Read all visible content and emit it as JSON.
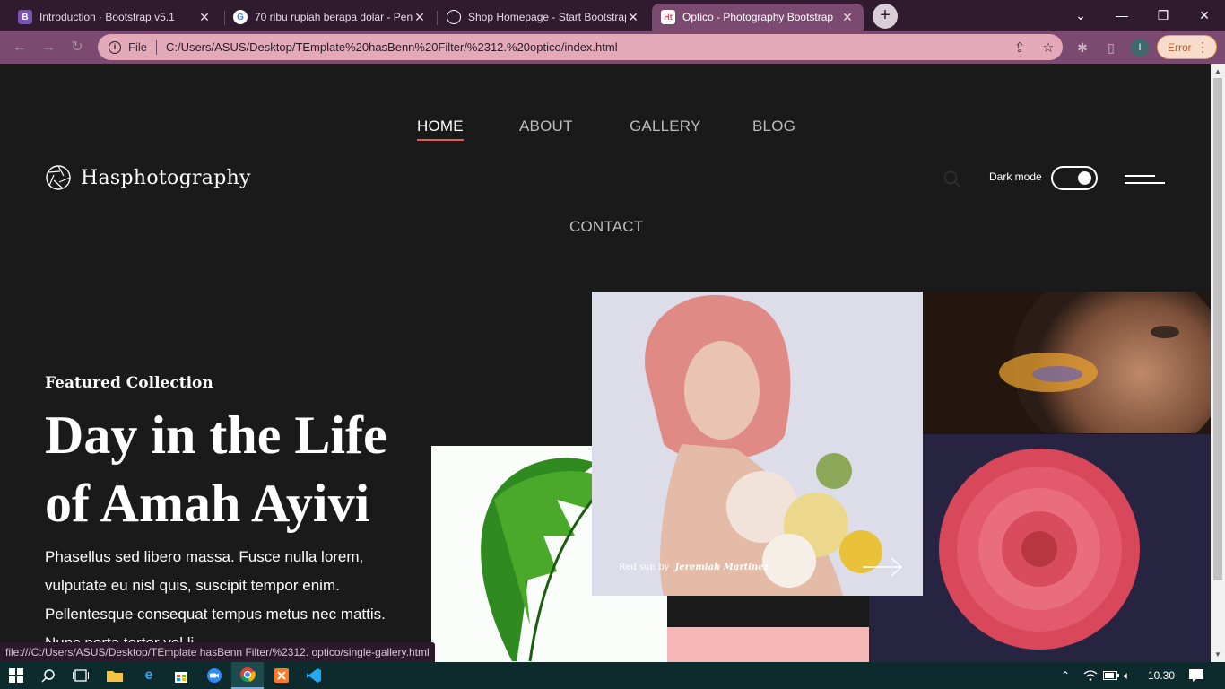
{
  "browser": {
    "tabs": [
      {
        "title": "Introduction · Bootstrap v5.1",
        "favicon": "B",
        "favicon_color": "#7952b3"
      },
      {
        "title": "70 ribu rupiah berapa dolar - Pen",
        "favicon": "G",
        "favicon_color": "#ffffff"
      },
      {
        "title": "Shop Homepage - Start Bootstrap",
        "favicon": "globe",
        "favicon_color": "#ffffff"
      },
      {
        "title": "Optico - Photography Bootstrap",
        "favicon": "Ht",
        "favicon_color": "#ffffff"
      }
    ],
    "active_tab": 3,
    "address": {
      "scheme_label": "File",
      "url": "C:/Users/ASUS/Desktop/TEmplate%20hasBenn%20Filter/%2312.%20optico/index.html"
    },
    "profile_initial": "I",
    "error_label": "Error"
  },
  "site": {
    "nav": {
      "home": "HOME",
      "about": "ABOUT",
      "gallery": "GALLERY",
      "blog": "BLOG",
      "contact": "CONTACT"
    },
    "brand": "Hasphotography",
    "dark_mode_label": "Dark mode",
    "dark_mode_on": true,
    "hero": {
      "eyebrow": "Featured Collection",
      "title": "Day in the Life of Amah Ayivi",
      "text": "Phasellus sed libero massa. Fusce nulla lorem, vulputate eu nisl quis, suscipit tempor enim. Pellentesque consequat tempus metus nec mattis. Nunc porta tortor vel li"
    },
    "featured_caption": {
      "prefix": "Red sun by",
      "author": "Jeremiah Martinez"
    }
  },
  "status_url": "file:///C:/Users/ASUS/Desktop/TEmplate hasBenn Filter/%2312. optico/single-gallery.html",
  "taskbar": {
    "time": "10.30"
  },
  "colors": {
    "page_bg": "#1a1a1a",
    "accent_underline": "#e25c4f",
    "tab_strip": "#2f1a2e",
    "toolbar": "#7a4a70",
    "omnibox": "#e4a9b8"
  }
}
